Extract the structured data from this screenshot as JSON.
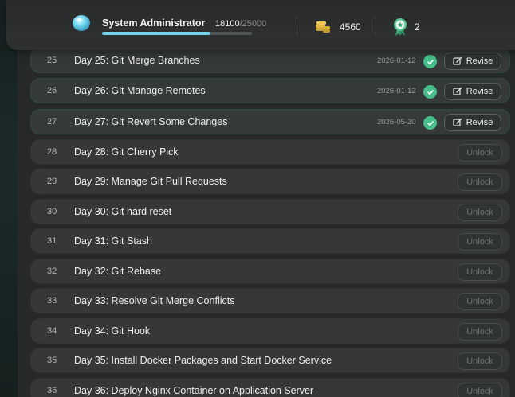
{
  "header": {
    "user_name": "System Administrator",
    "xp_current": "18100",
    "xp_max": "/25000",
    "xp_progress": 0.724,
    "coins": "4560",
    "badges": "2"
  },
  "rows": [
    {
      "num": "25",
      "title": "Day 25: Git Merge Branches",
      "date": "2026-01-12",
      "status": "completed",
      "action": "Revise"
    },
    {
      "num": "26",
      "title": "Day 26: Git Manage Remotes",
      "date": "2026-01-12",
      "status": "completed",
      "action": "Revise"
    },
    {
      "num": "27",
      "title": "Day 27: Git Revert Some Changes",
      "date": "2026-05-20",
      "status": "completed",
      "action": "Revise"
    },
    {
      "num": "28",
      "title": "Day 28: Git Cherry Pick",
      "date": "",
      "status": "locked",
      "action": "Unlock"
    },
    {
      "num": "29",
      "title": "Day 29: Manage Git Pull Requests",
      "date": "",
      "status": "locked",
      "action": "Unlock"
    },
    {
      "num": "30",
      "title": "Day 30: Git hard reset",
      "date": "",
      "status": "locked",
      "action": "Unlock"
    },
    {
      "num": "31",
      "title": "Day 31: Git Stash",
      "date": "",
      "status": "locked",
      "action": "Unlock"
    },
    {
      "num": "32",
      "title": "Day 32: Git Rebase",
      "date": "",
      "status": "locked",
      "action": "Unlock"
    },
    {
      "num": "33",
      "title": "Day 33: Resolve Git Merge Conflicts",
      "date": "",
      "status": "locked",
      "action": "Unlock"
    },
    {
      "num": "34",
      "title": "Day 34: Git Hook",
      "date": "",
      "status": "locked",
      "action": "Unlock"
    },
    {
      "num": "35",
      "title": "Day 35: Install Docker Packages and Start Docker Service",
      "date": "",
      "status": "locked",
      "action": "Unlock"
    },
    {
      "num": "36",
      "title": "Day 36: Deploy Nginx Container on Application Server",
      "date": "",
      "status": "locked",
      "action": "Unlock"
    }
  ],
  "colors": {
    "accent_xp": "#6fd3ec",
    "check_green": "#48c08c"
  }
}
